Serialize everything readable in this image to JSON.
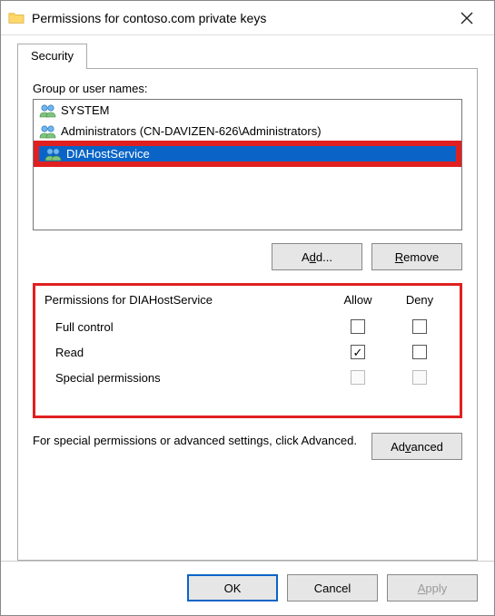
{
  "window": {
    "title": "Permissions for contoso.com private keys"
  },
  "tabs": {
    "active": "Security"
  },
  "groups": {
    "label": "Group or user names:",
    "items": [
      {
        "name": "SYSTEM",
        "selected": false
      },
      {
        "name": "Administrators (CN-DAVIZEN-626\\Administrators)",
        "selected": false
      },
      {
        "name": "DIAHostService",
        "selected": true
      }
    ],
    "buttons": {
      "add": "Add...",
      "remove": "Remove"
    }
  },
  "permissions": {
    "header_for": "Permissions for DIAHostService",
    "col_allow": "Allow",
    "col_deny": "Deny",
    "rows": [
      {
        "name": "Full control",
        "allow": false,
        "deny": false,
        "disabled": false
      },
      {
        "name": "Read",
        "allow": true,
        "deny": false,
        "disabled": false
      },
      {
        "name": "Special permissions",
        "allow": false,
        "deny": false,
        "disabled": true
      }
    ]
  },
  "advanced": {
    "text": "For special permissions or advanced settings, click Advanced.",
    "button": "Advanced"
  },
  "footer": {
    "ok": "OK",
    "cancel": "Cancel",
    "apply": "Apply"
  }
}
